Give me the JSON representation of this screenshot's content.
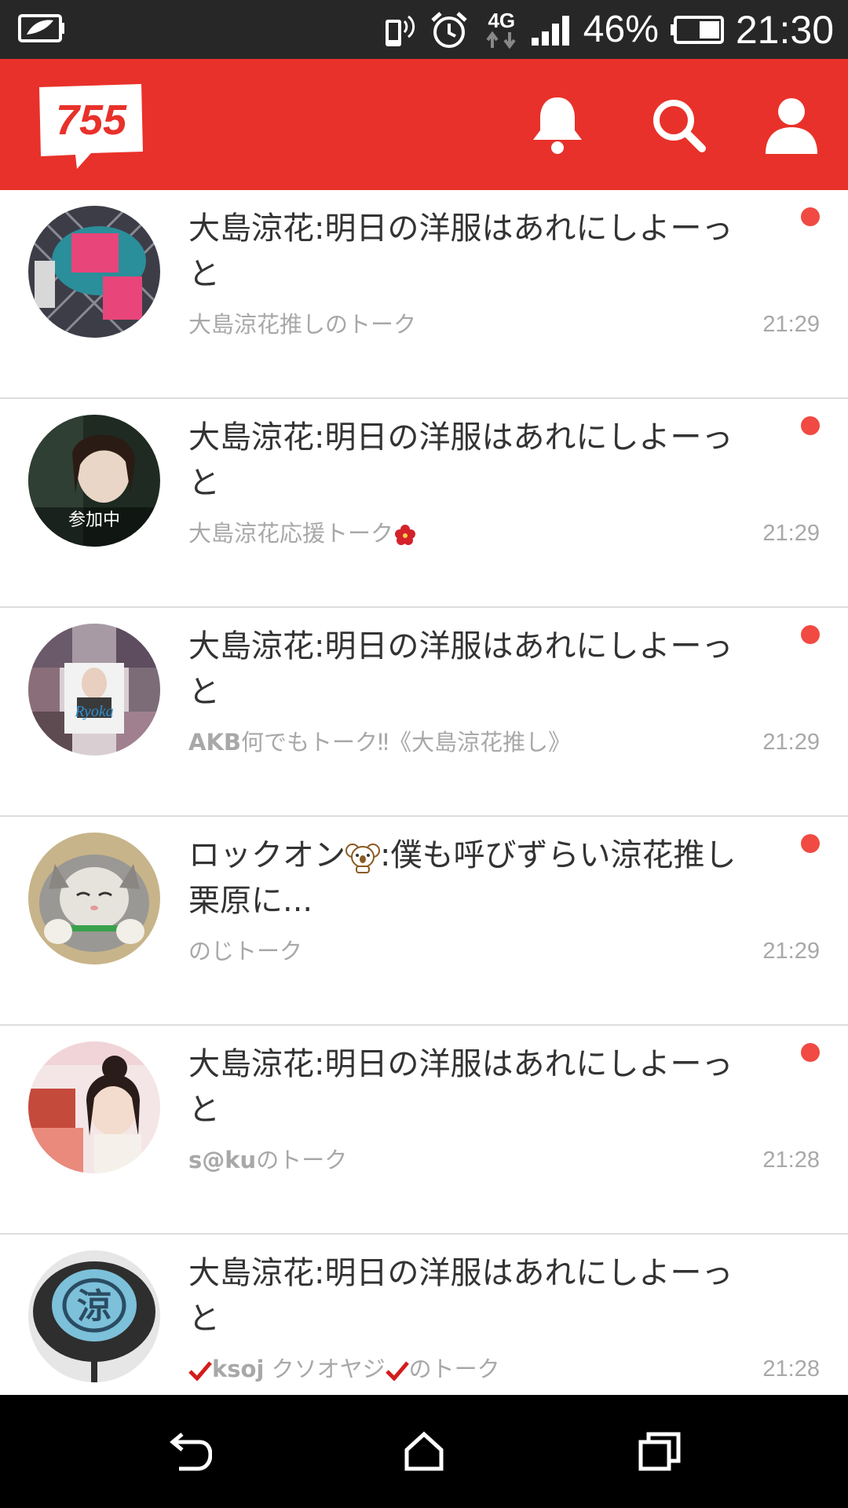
{
  "status_bar": {
    "network": "4G",
    "battery": "46%",
    "time": "21:30"
  },
  "header": {
    "logo_text": "755",
    "accent_color": "#e8312a"
  },
  "talks": [
    {
      "message_line1": "大島涼花:明日の洋服はあれにしよーっ",
      "message_line2": "と",
      "room": "大島涼花推しのトーク",
      "time": "21:29",
      "unread": true
    },
    {
      "message_line1": "大島涼花:明日の洋服はあれにしよーっ",
      "message_line2": "と",
      "room": "大島涼花応援トーク",
      "time": "21:29",
      "unread": true,
      "avatar_badge": "参加中"
    },
    {
      "message_line1": "大島涼花:明日の洋服はあれにしよーっ",
      "message_line2": "と",
      "room_bold": "AKB",
      "room": "何でもトーク‼《大島涼花推し》",
      "time": "21:29",
      "unread": true
    },
    {
      "message_sender": "ロックオン",
      "message_line1_rest": ":僕も呼びずらい涼花推し",
      "message_line2": "栗原に...",
      "room": "のじトーク",
      "time": "21:29",
      "unread": true
    },
    {
      "message_line1": "大島涼花:明日の洋服はあれにしよーっ",
      "message_line2": "と",
      "room_bold": "s@ku",
      "room": "のトーク",
      "time": "21:28",
      "unread": true
    },
    {
      "message_line1": "大島涼花:明日の洋服はあれにしよーっ",
      "message_line2": "と",
      "room_bold": "ksoj",
      "room_mid": " クソオヤジ",
      "room": "のトーク",
      "time": "21:28",
      "unread": false
    }
  ],
  "icons": [
    "battery-saver-icon",
    "vibrate-icon",
    "alarm-icon",
    "signal-icon",
    "battery-icon",
    "bell-icon",
    "search-icon",
    "profile-icon",
    "back-icon",
    "home-icon",
    "recents-icon"
  ]
}
